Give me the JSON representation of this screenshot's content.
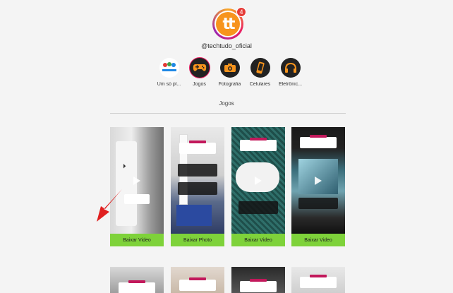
{
  "profile": {
    "avatar_text": "tt",
    "badge_count": "4",
    "username": "@techtudo_oficial"
  },
  "highlights": [
    {
      "label": "Um só pl...",
      "icon": "planeta-logo-icon"
    },
    {
      "label": "Jogos",
      "icon": "gamepad-icon",
      "active": true
    },
    {
      "label": "Fotografia",
      "icon": "camera-icon"
    },
    {
      "label": "Celulares",
      "icon": "phone-icon"
    },
    {
      "label": "Eletrônic...",
      "icon": "headphones-icon"
    }
  ],
  "section": {
    "title": "Jogos"
  },
  "posts": [
    {
      "button": "Baixar Video",
      "type": "video"
    },
    {
      "button": "Baixar Photo",
      "type": "photo"
    },
    {
      "button": "Baixar Video",
      "type": "video"
    },
    {
      "button": "Baixar Video",
      "type": "video"
    }
  ],
  "colors": {
    "button": "#7ed23a",
    "accent": "#e53935",
    "avatar": "#f7941d"
  }
}
